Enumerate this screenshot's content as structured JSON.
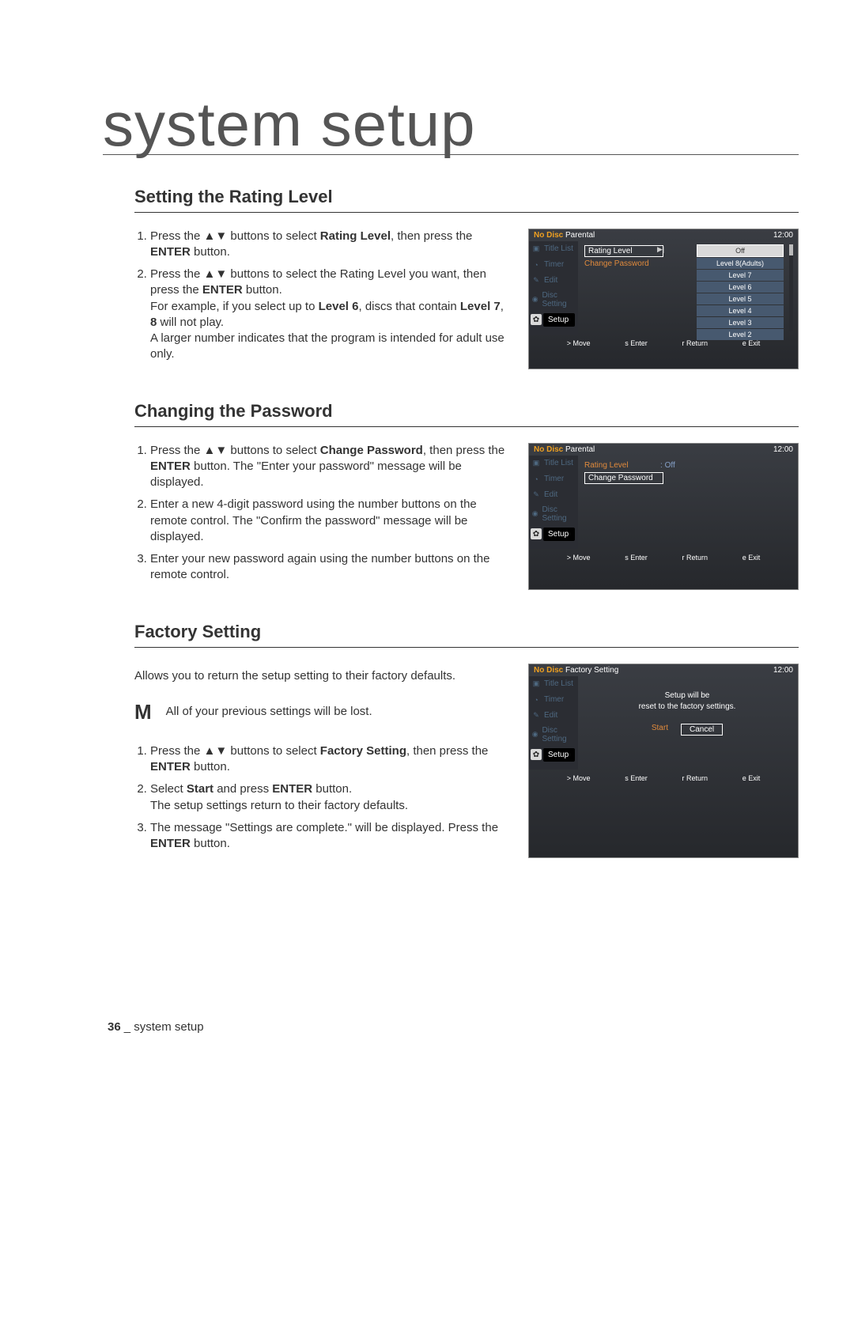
{
  "page_title": "system setup",
  "sections": {
    "rating": {
      "heading": "Setting the Rating Level",
      "steps": [
        "Press the ▲▼ buttons to select Rating Level, then press the ENTER button.",
        "Press the ▲▼ buttons to select the Rating Level you want, then press the ENTER button.",
        "For example, if you select up to Level 6, discs that contain Level 7, 8 will not play.",
        "A larger number indicates that the program is intended for adult use only."
      ]
    },
    "password": {
      "heading": "Changing the Password",
      "steps": [
        "Press the ▲▼ buttons to select Change Password, then press the ENTER button. The \"Enter your password\" message will be displayed.",
        "Enter a new 4-digit password using the number buttons on the remote control. The \"Confirm the password\" message will be displayed.",
        "Enter your new password again using the number buttons on the remote control."
      ]
    },
    "factory": {
      "heading": "Factory Setting",
      "intro": "Allows you to return the setup setting to their factory defaults.",
      "note_symbol": "M",
      "note_text": "All of your previous settings will be lost.",
      "steps": [
        "Press the ▲▼ buttons to select Factory Setting, then press the ENTER button.",
        "Select Start and press ENTER button. The setup settings return to their factory defaults.",
        "The message \"Settings are complete.\" will be displayed. Press the ENTER button."
      ]
    }
  },
  "panels": {
    "common": {
      "no_disc": "No Disc",
      "time": "12:00",
      "sidebar": [
        "Title List",
        "Timer",
        "Edit",
        "Disc Setting",
        "Setup"
      ],
      "side_icons": [
        "▣",
        "◔",
        "✎",
        "◉",
        "✿"
      ],
      "footer": {
        "move": "> Move",
        "enter": "s Enter",
        "return": "r Return",
        "exit": "e Exit"
      }
    },
    "rating": {
      "title": "Parental",
      "opt_rating": "Rating Level",
      "opt_pwd": "Change Password",
      "levels": [
        "Off",
        "Level 8(Adults)",
        "Level 7",
        "Level 6",
        "Level 5",
        "Level 4",
        "Level 3",
        "Level 2"
      ],
      "selected": "Off"
    },
    "password": {
      "title": "Parental",
      "opt_rating": "Rating Level",
      "opt_rating_val": "Off",
      "opt_pwd": "Change Password"
    },
    "factory": {
      "title": "Factory Setting",
      "msg1": "Setup will be",
      "msg2": "reset to the factory settings.",
      "start": "Start",
      "cancel": "Cancel"
    }
  },
  "footer": {
    "page_num": "36",
    "page_label": "_ system setup"
  }
}
